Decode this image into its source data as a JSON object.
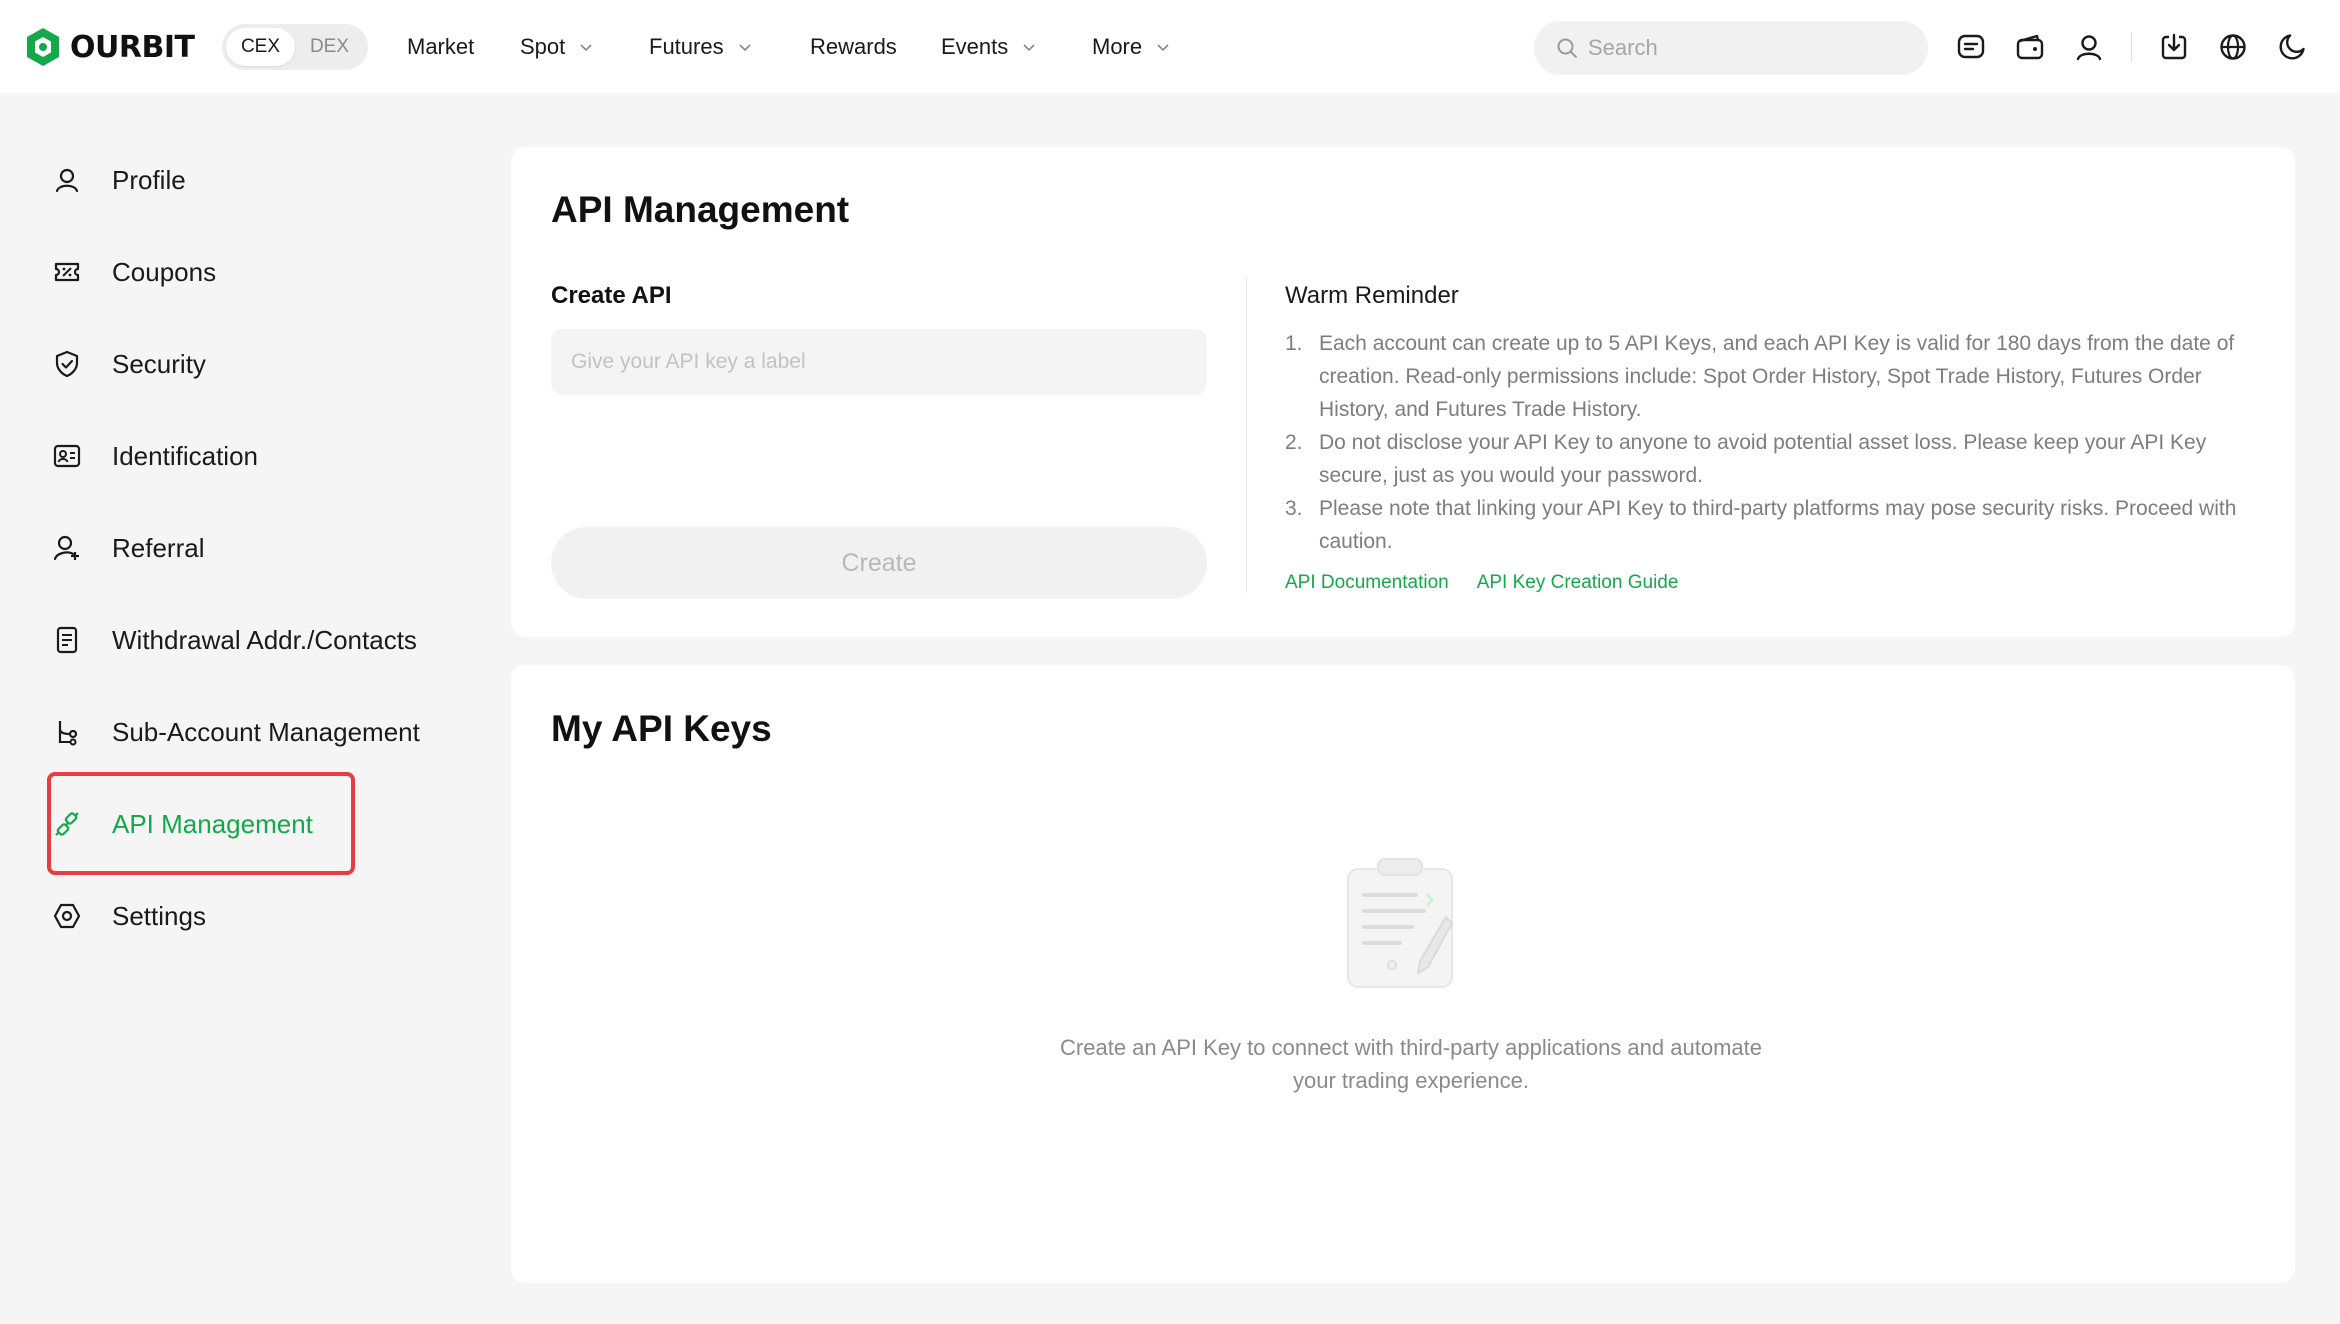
{
  "brand": {
    "name": "OURBIT",
    "accent": "#14a84a"
  },
  "topnav": {
    "mode_toggle": [
      {
        "label": "CEX",
        "active": true
      },
      {
        "label": "DEX",
        "active": false
      }
    ],
    "items": [
      {
        "label": "Market",
        "has_dropdown": false
      },
      {
        "label": "Spot",
        "has_dropdown": true
      },
      {
        "label": "Futures",
        "has_dropdown": true
      },
      {
        "label": "Rewards",
        "has_dropdown": false
      },
      {
        "label": "Events",
        "has_dropdown": true
      },
      {
        "label": "More",
        "has_dropdown": true
      }
    ],
    "search_placeholder": "Search",
    "icons": [
      "messages-icon",
      "wallet-icon",
      "account-icon",
      "download-icon",
      "globe-icon",
      "moon-icon"
    ]
  },
  "sidebar": {
    "items": [
      {
        "label": "Profile",
        "icon": "user-icon",
        "active": false
      },
      {
        "label": "Coupons",
        "icon": "coupon-icon",
        "active": false
      },
      {
        "label": "Security",
        "icon": "shield-icon",
        "active": false
      },
      {
        "label": "Identification",
        "icon": "id-card-icon",
        "active": false
      },
      {
        "label": "Referral",
        "icon": "user-plus-icon",
        "active": false
      },
      {
        "label": "Withdrawal Addr./Contacts",
        "icon": "address-book-icon",
        "active": false
      },
      {
        "label": "Sub-Account Management",
        "icon": "sub-account-icon",
        "active": false
      },
      {
        "label": "API Management",
        "icon": "api-link-icon",
        "active": true
      },
      {
        "label": "Settings",
        "icon": "settings-icon",
        "active": false
      }
    ]
  },
  "api_management": {
    "title": "API Management",
    "create_label": "Create API",
    "input_placeholder": "Give your API key a label",
    "create_button": "Create",
    "reminder_title": "Warm Reminder",
    "reminders": [
      {
        "num": "1.",
        "text": "Each account can create up to 5 API Keys, and each API Key is valid for 180 days from the date of creation. Read-only permissions include: Spot Order History, Spot Trade History, Futures Order History, and Futures Trade History."
      },
      {
        "num": "2.",
        "text": "Do not disclose your API Key to anyone to avoid potential asset loss. Please keep your API Key secure, just as you would your password."
      },
      {
        "num": "3.",
        "text": "Please note that linking your API Key to third-party platforms may pose security risks. Proceed with caution."
      }
    ],
    "links": [
      "API Documentation",
      "API Key Creation Guide"
    ]
  },
  "my_api_keys": {
    "title": "My API Keys",
    "empty_text": "Create an API Key to connect with third-party applications and automate your trading experience."
  }
}
